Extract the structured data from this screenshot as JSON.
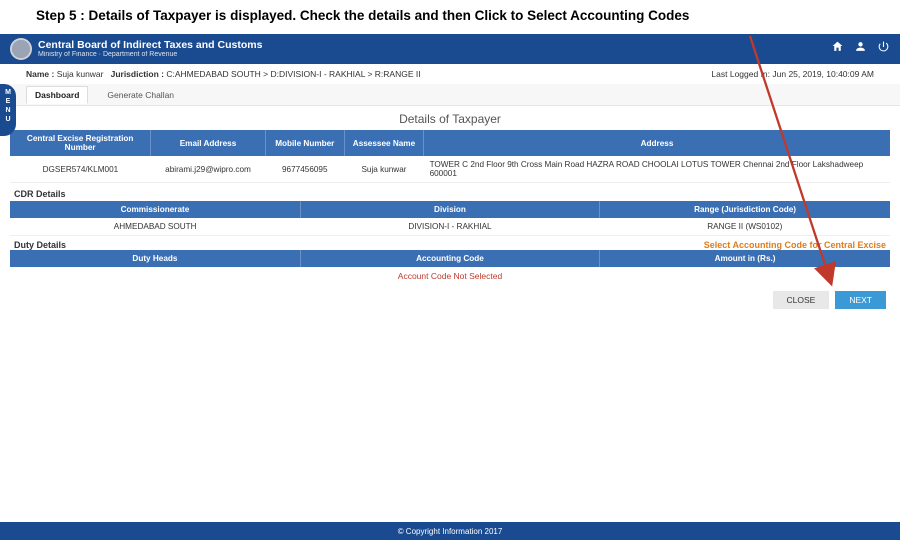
{
  "step": "Step 5 :  Details of Taxpayer is displayed. Check the details and  then Click to Select Accounting Codes",
  "org": {
    "title": "Central Board of Indirect Taxes and Customs",
    "sub": "Ministry of Finance · Department of Revenue"
  },
  "menuLabel": "M\nE\nN\nU",
  "meta": {
    "nameLbl": "Name :",
    "nameVal": "Suja kunwar",
    "jurisLbl": "Jurisdiction :",
    "jurisVal": "C:AHMEDABAD SOUTH > D:DIVISION-I - RAKHIAL > R:RANGE II",
    "lastLogin": "Last Logged In: Jun 25, 2019, 10:40:09 AM"
  },
  "tabs": {
    "dashboard": "Dashboard",
    "generate": "Generate Challan"
  },
  "pageTitle": "Details of Taxpayer",
  "taxpayer": {
    "headers": {
      "reg": "Central Excise Registration Number",
      "email": "Email Address",
      "mobile": "Mobile Number",
      "assessee": "Assessee Name",
      "address": "Address"
    },
    "row": {
      "reg": "DGSER574/KLM001",
      "email": "abirami.j29@wipro.com",
      "mobile": "9677456095",
      "assessee": "Suja kunwar",
      "address": "TOWER C 2nd Floor 9th Cross Main Road HAZRA ROAD CHOOLAI LOTUS TOWER Chennai 2nd Floor Lakshadweep 600001"
    }
  },
  "cdr": {
    "label": "CDR Details",
    "headers": {
      "comm": "Commissionerate",
      "div": "Division",
      "range": "Range (Jurisdiction Code)"
    },
    "row": {
      "comm": "AHMEDABAD SOUTH",
      "div": "DIVISION-I - RAKHIAL",
      "range": "RANGE II (WS0102)"
    }
  },
  "duty": {
    "label": "Duty Details",
    "selectLink": "Select Accounting Code for Central Excise",
    "headers": {
      "heads": "Duty Heads",
      "code": "Accounting Code",
      "amount": "Amount in (Rs.)"
    },
    "noSel": "Account Code Not Selected"
  },
  "buttons": {
    "close": "CLOSE",
    "next": "NEXT"
  },
  "footer": "© Copyright Information 2017"
}
